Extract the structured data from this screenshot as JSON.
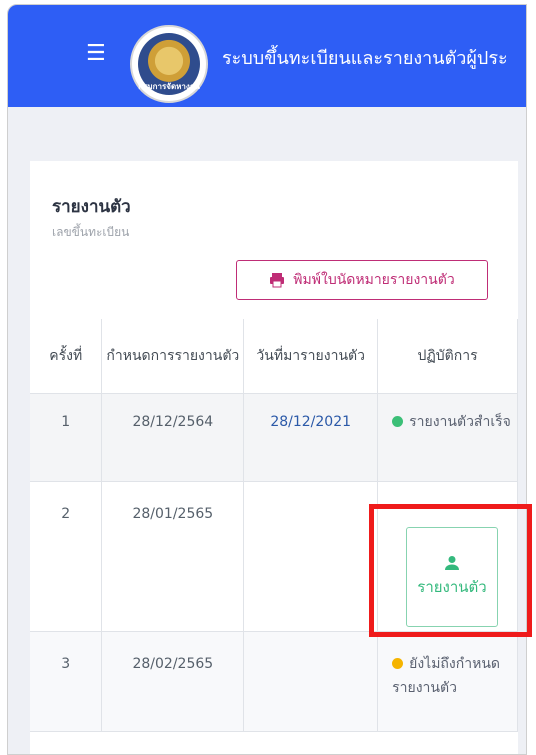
{
  "header": {
    "menu_icon": "☰",
    "logo_label": "กรมการจัดหางาน",
    "title": "ระบบขึ้นทะเบียนและรายงานตัวผู้ประ"
  },
  "card": {
    "title": "รายงานตัว",
    "subtitle": "เลขขึ้นทะเบียน",
    "print_button": "พิมพ์ใบนัดหมายรายงานตัว"
  },
  "table": {
    "columns": [
      "ครั้งที่",
      "กำหนดการรายงานตัว",
      "วันที่มารายงานตัว",
      "ปฏิบัติการ"
    ],
    "rows": [
      {
        "no": "1",
        "due": "28/12/2564",
        "arrival": "28/12/2021",
        "action": "รายงานตัวสำเร็จ"
      },
      {
        "no": "2",
        "due": "28/01/2565",
        "arrival": "",
        "action": "รายงานตัว"
      },
      {
        "no": "3",
        "due": "28/02/2565",
        "arrival": "",
        "action": "ยังไม่ถึงกำหนดรายงานตัว"
      }
    ]
  },
  "colors": {
    "header": "#2e5ef5",
    "accent": "#bf2d76",
    "success": "#3bbf77",
    "pending": "#f5b400",
    "highlight": "#ef1b1b"
  }
}
